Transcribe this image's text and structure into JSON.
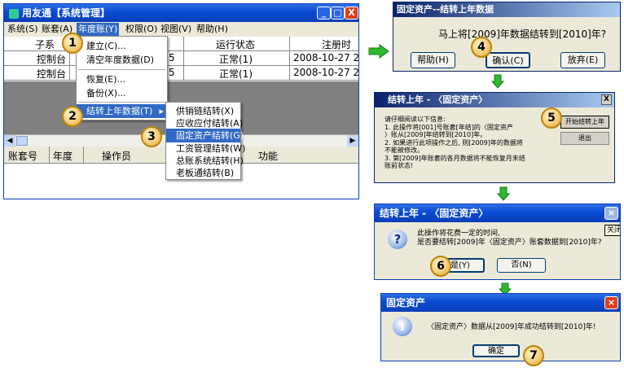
{
  "main_window": {
    "title": "用友通【系统管理】",
    "controls": {
      "minimize": "_",
      "maximize": "□",
      "close": "X"
    },
    "menubar": [
      "系统(S)",
      "账套(A)",
      "年度账(Y)",
      "权限(O)",
      "视图(V)",
      "帮助(H)"
    ],
    "grid_top": {
      "headers": [
        "子系",
        "运行状态",
        "注册时"
      ],
      "rows": [
        [
          "控制台",
          "5",
          "正常(1)",
          "2008-10-27 2"
        ],
        [
          "控制台",
          "5",
          "正常(1)",
          "2008-10-27 2"
        ]
      ]
    },
    "grid_bottom": {
      "headers": [
        "账套号",
        "年度",
        "操作员",
        "功能"
      ]
    }
  },
  "year_menu": {
    "items": [
      "建立(C)...",
      "清空年度数据(D)",
      "恢复(E)...",
      "备份(X)...",
      "结转上年数据(T)"
    ]
  },
  "submenu": {
    "items": [
      "供销链结转(X)",
      "应收应付结转(A)",
      "固定资产结转(G)",
      "工资管理结转(W)",
      "总账系统结转(H)",
      "老板通结转(B)"
    ],
    "selected_index": 2
  },
  "dialog_confirm": {
    "title": "固定资产--结转上年数据",
    "message": "马上将[2009]年数据结转到[2010]年?",
    "buttons": [
      "帮助(H)",
      "确认(C)",
      "放弃(E)"
    ]
  },
  "dialog_info": {
    "title": "结转上年 - 〈固定资产〉",
    "close": "X",
    "lines": [
      "请仔细阅读以下信息:",
      "1. 此操作将[001]号账套[年结]的〈固定资产",
      "〉账从[2009]年结转到[2010]年。",
      "2. 如果进行此项操作之后, 则[2009]年的数据将",
      "不能被修改。",
      "3. 第[2009]年账套的各月数据将不能恢复月末结",
      "账前状态!"
    ],
    "buttons": [
      "开始结转上年",
      "退出"
    ]
  },
  "dialog_question": {
    "title": "结转上年 - 〈固定资产〉",
    "partial": "关闭",
    "icon": "?",
    "lines": [
      "此操作将花费一定的时间,",
      "是否要结转[2009]年〈固定资产〉账套数据到[2010]年?"
    ],
    "buttons": [
      "是(Y)",
      "否(N)"
    ]
  },
  "dialog_done": {
    "title": "固定资产",
    "icon": "i",
    "message": "〈固定资产〉数据从[2009]年成功结转到[2010]年!",
    "button": "确定"
  },
  "steps": [
    "1",
    "2",
    "3",
    "4",
    "5",
    "6",
    "7"
  ],
  "colors": {
    "xp_blue": "#0a4ad0",
    "classic_blue": "#0a246a",
    "arrow_green": "#2eb82e",
    "highlight": "#316ac5",
    "step_circle": "#f4c870"
  }
}
